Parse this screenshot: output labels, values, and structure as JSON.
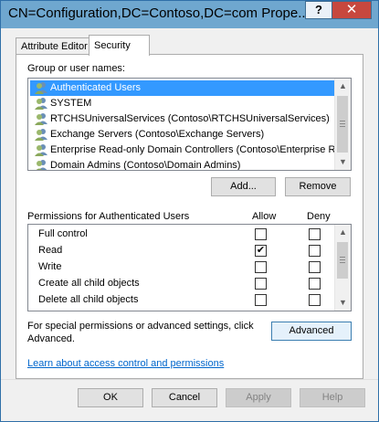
{
  "window": {
    "title": "CN=Configuration,DC=Contoso,DC=com Prope...",
    "help_glyph": "?",
    "close_glyph": "✕"
  },
  "tabs": [
    {
      "label": "Attribute Editor"
    },
    {
      "label": "Security"
    }
  ],
  "groups": {
    "label": "Group or user names:",
    "items": [
      {
        "label": "Authenticated Users",
        "icon": "users-icon"
      },
      {
        "label": "SYSTEM",
        "icon": "users-icon"
      },
      {
        "label": "RTCHSUniversalServices (Contoso\\RTCHSUniversalServices)",
        "icon": "users-icon"
      },
      {
        "label": "Exchange Servers (Contoso\\Exchange Servers)",
        "icon": "users-icon"
      },
      {
        "label": "Enterprise Read-only Domain Controllers (Contoso\\Enterprise R...",
        "icon": "users-icon"
      },
      {
        "label": "Domain Admins (Contoso\\Domain Admins)",
        "icon": "users-icon"
      }
    ],
    "selected_index": 0,
    "add_label": "Add...",
    "remove_label": "Remove"
  },
  "permissions": {
    "title": "Permissions for Authenticated Users",
    "allow_header": "Allow",
    "deny_header": "Deny",
    "rows": [
      {
        "name": "Full control",
        "allow": false,
        "deny": false
      },
      {
        "name": "Read",
        "allow": true,
        "deny": false
      },
      {
        "name": "Write",
        "allow": false,
        "deny": false
      },
      {
        "name": "Create all child objects",
        "allow": false,
        "deny": false
      },
      {
        "name": "Delete all child objects",
        "allow": false,
        "deny": false
      }
    ]
  },
  "advanced": {
    "text_line1": "For special permissions or advanced settings, click",
    "text_line2": "Advanced.",
    "button_label": "Advanced"
  },
  "link": "Learn about access control and permissions",
  "footer": {
    "ok": "OK",
    "cancel": "Cancel",
    "apply": "Apply",
    "help": "Help"
  },
  "colors": {
    "titlebar": "#6fa7cf",
    "close": "#c7483e",
    "selection": "#3399ff",
    "link": "#0066cc"
  }
}
